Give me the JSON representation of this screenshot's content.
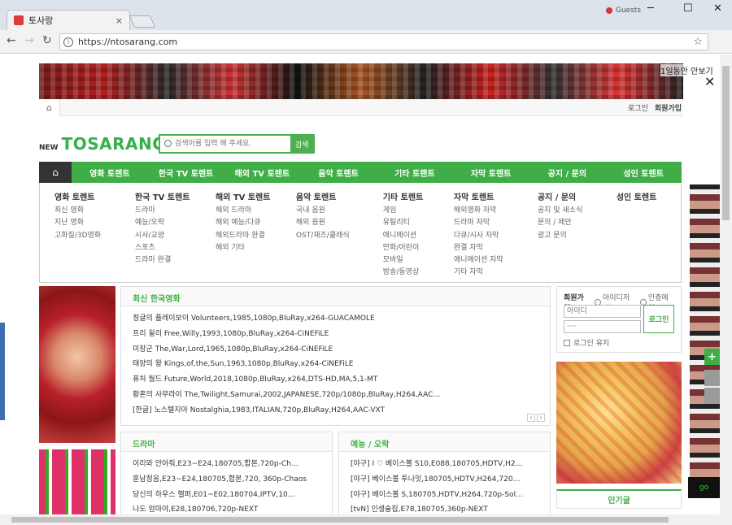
{
  "browser": {
    "tab_title": "토사랑",
    "tab_close": "×",
    "user_name": "Guests",
    "url": "https://ntosarang.com",
    "minimize": "─",
    "maximize": "☐",
    "close": "✕"
  },
  "ad": {
    "note": "1일동안 안보기",
    "close": "✕"
  },
  "topbar": {
    "login": "로그인",
    "join": "회원가입"
  },
  "logo": {
    "prefix": "NEW",
    "name": "TOSARANG"
  },
  "search": {
    "placeholder": "검색어를 입력 해 주세요.",
    "button": "검색"
  },
  "nav": [
    "영화 토렌트",
    "한국 TV 토렌트",
    "해외 TV 토렌트",
    "음악 토렌트",
    "기타 토렌트",
    "자막 토렌트",
    "공지 / 문의",
    "성인 토렌트"
  ],
  "dropdown": [
    {
      "title": "영화 토렌트",
      "items": [
        "최신 영화",
        "지난 영화",
        "고화질/3D영화"
      ]
    },
    {
      "title": "한국 TV 토렌트",
      "items": [
        "드라마",
        "예능/오락",
        "시사/교양",
        "스포츠",
        "드라마 완결"
      ]
    },
    {
      "title": "해외 TV 토렌트",
      "items": [
        "해외 드라마",
        "해외 예능/다큐",
        "해외드라마 완결",
        "해외 기타"
      ]
    },
    {
      "title": "음악 토렌트",
      "items": [
        "국내 음원",
        "해외 음원",
        "OST/재즈/클래식"
      ]
    },
    {
      "title": "기타 토렌트",
      "items": [
        "게임",
        "유틸리티",
        "애니메이션",
        "만화/어린이",
        "모바일",
        "방송/동영상"
      ]
    },
    {
      "title": "자막 토렌트",
      "items": [
        "해외영화 자막",
        "드라마 자막",
        "다큐/시사 자막",
        "완결 자막",
        "애니메이션 자막",
        "기타 자막"
      ]
    },
    {
      "title": "공지 / 문의",
      "items": [
        "공지 및 새소식",
        "문의 / 제안",
        "광고 문의"
      ]
    },
    {
      "title": "성인 토렌트",
      "items": []
    }
  ],
  "movies": {
    "title": "최신 한국영화",
    "items": [
      "정글의 플레이보이 Volunteers,1985,1080p,BluRay,x264-GUACAMOLE",
      "프리 윌리 Free,Willy,1993,1080p,BluRay,x264-CiNEFiLE",
      "미장군 The,War,Lord,1965,1080p,BluRay,x264-CiNEFiLE",
      "태양의 왕 Kings,of,the,Sun,1963,1080p,BluRay,x264-CiNEFiLE",
      "퓨처 월드 Future,World,2018,1080p,BluRay,x264,DTS-HD,MA,5,1-MT",
      "황혼의 사무라이 The,Twilight,Samurai,2002,JAPANESE,720p/1080p,BluRay,H264,AAC…",
      "[한글] 노스텔지아 Nostalghia,1983,ITALIAN,720p,BluRay,H264,AAC-VXT"
    ],
    "prev": "‹",
    "next": "›"
  },
  "drama": {
    "title": "드라마",
    "items": [
      "이리와 안아줘,E23~E24,180705,합본,720p-Ch…",
      "훈남정음,E23~E24,180705,합본,720, 360p-Chaos",
      "당신의 하우스 헬퍼,E01~E02,180704,IPTV,10…",
      "나도 엄마야,E28,180706,720p-NEXT"
    ]
  },
  "variety": {
    "title": "예능 / 오락",
    "items": [
      "[야구] I ♡ 베이스볼 S10,E088,180705,HDTV,H2…",
      "[야구] 베이스볼 투나잇,180705,HDTV,H264,720…",
      "[야구] 베이스볼 S,180705,HDTV,H264,720p-Sol…",
      "[tvN] 인생술집,E78,180705,360p-NEXT"
    ]
  },
  "login": {
    "title": "회원가입",
    "opt1": "아이디저번",
    "opt2": "인증메일",
    "id_placeholder": "아이디",
    "pw_value": "····",
    "button": "로그인",
    "keep": "로그인 유지"
  },
  "popular": "인기글",
  "side_label": "go"
}
